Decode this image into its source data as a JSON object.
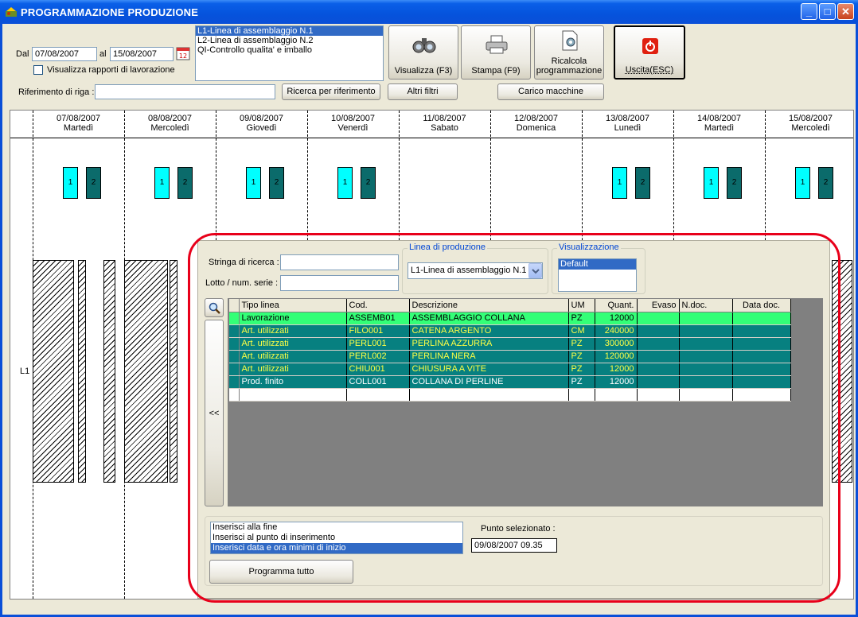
{
  "window": {
    "title": "PROGRAMMAZIONE PRODUZIONE"
  },
  "filters": {
    "dal_label": "Dal",
    "date_from": "07/08/2007",
    "al_label": "al",
    "date_to": "15/08/2007",
    "show_reports_label": "Visualizza rapporti di lavorazione",
    "ref_label": "Riferimento di riga :",
    "ref_value": ""
  },
  "lines_list": [
    "L1-Linea di assemblaggio N.1",
    "L2-Linea di assemblaggio N.2",
    "QI-Controllo qualita' e imballo"
  ],
  "toolbar": {
    "visualizza": "Visualizza (F3)",
    "stampa": "Stampa (F9)",
    "ricalcola_1": "Ricalcola",
    "ricalcola_2": "programmazione",
    "uscita": "Uscita(ESC)",
    "ricerca_rif": "Ricerca per riferimento",
    "altri_filtri": "Altri filtri",
    "carico_macchine": "Carico macchine"
  },
  "schedule": {
    "days": [
      {
        "date": "07/08/2007",
        "name": "Martedì"
      },
      {
        "date": "08/08/2007",
        "name": "Mercoledì"
      },
      {
        "date": "09/08/2007",
        "name": "Giovedì"
      },
      {
        "date": "10/08/2007",
        "name": "Venerdì"
      },
      {
        "date": "11/08/2007",
        "name": "Sabato"
      },
      {
        "date": "12/08/2007",
        "name": "Domenica"
      },
      {
        "date": "13/08/2007",
        "name": "Lunedì"
      },
      {
        "date": "14/08/2007",
        "name": "Martedì"
      },
      {
        "date": "15/08/2007",
        "name": "Mercoledì"
      }
    ],
    "shift_1": "1",
    "shift_2": "2",
    "row_label": "L1"
  },
  "panel": {
    "search_label": "Stringa di ricerca :",
    "search_value": "",
    "lot_label": "Lotto / num. serie :",
    "lot_value": "",
    "linea_legend": "Linea di produzione",
    "linea_value": "L1-Linea di assemblaggio N.1",
    "vis_legend": "Visualizzazione",
    "vis_value": "Default",
    "collapse_label": "<<",
    "columns": [
      "Tipo linea",
      "Cod.",
      "Descrizione",
      "UM",
      "Quant.",
      "Evaso",
      "N.doc.",
      "Data doc."
    ],
    "rows": [
      {
        "tipo": "Lavorazione",
        "cod": "ASSEMB01",
        "desc": "ASSEMBLAGGIO COLLANA",
        "um": "PZ",
        "quant": "12000"
      },
      {
        "tipo": "Art. utilizzati",
        "cod": "FILO001",
        "desc": "CATENA ARGENTO",
        "um": "CM",
        "quant": "240000"
      },
      {
        "tipo": "Art. utilizzati",
        "cod": "PERL001",
        "desc": "PERLINA AZZURRA",
        "um": "PZ",
        "quant": "300000"
      },
      {
        "tipo": "Art. utilizzati",
        "cod": "PERL002",
        "desc": "PERLINA NERA",
        "um": "PZ",
        "quant": "120000"
      },
      {
        "tipo": "Art. utilizzati",
        "cod": "CHIU001",
        "desc": "CHIUSURA A VITE",
        "um": "PZ",
        "quant": "12000"
      },
      {
        "tipo": "Prod. finito",
        "cod": "COLL001",
        "desc": "COLLANA DI PERLINE",
        "um": "PZ",
        "quant": "12000"
      }
    ],
    "insert_options": [
      "Inserisci alla fine",
      "Inserisci al punto di inserimento",
      "Inserisci data e ora minimi di inizio"
    ],
    "punto_label": "Punto selezionato :",
    "punto_value": "09/08/2007  09.35",
    "programma_tutto": "Programma tutto"
  }
}
